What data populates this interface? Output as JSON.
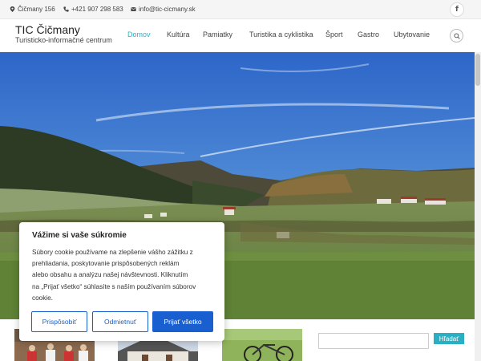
{
  "topbar": {
    "address": "Čičmany 156",
    "phone": "+421 907 298 583",
    "email": "info@tic-cicmany.sk",
    "facebook_label": "f"
  },
  "header": {
    "title": "TIC Čičmany",
    "subtitle": "Turisticko-informačné centrum"
  },
  "nav": {
    "items": [
      {
        "label": "Domov",
        "active": true
      },
      {
        "label": "Kultúra"
      },
      {
        "label": "Pamiatky"
      },
      {
        "label": "Turistika a cyklistika"
      },
      {
        "label": "Šport"
      },
      {
        "label": "Gastro"
      },
      {
        "label": "Ubytovanie"
      }
    ]
  },
  "sidebar_search": {
    "value": "",
    "button_label": "Hľadať"
  },
  "cookie": {
    "title": "Vážime si vaše súkromie",
    "lines": [
      "Súbory cookie používame na zlepšenie vášho zážitku z",
      "prehliadania, poskytovanie prispôsobených reklám",
      "alebo obsahu a analýzu našej návštevnosti. Kliknutím",
      "na „Prijať všetko“ súhlasíte s naším používaním súborov",
      "cookie."
    ],
    "customize_label": "Prispôsobiť",
    "reject_label": "Odmietnuť",
    "accept_label": "Prijať všetko"
  },
  "colors": {
    "accent": "#2ab0c2",
    "cookie_button": "#1a5fd0"
  },
  "icons": {
    "address": "map-marker-icon",
    "phone": "phone-icon",
    "email": "envelope-icon",
    "facebook": "facebook-icon",
    "search": "search-icon"
  }
}
